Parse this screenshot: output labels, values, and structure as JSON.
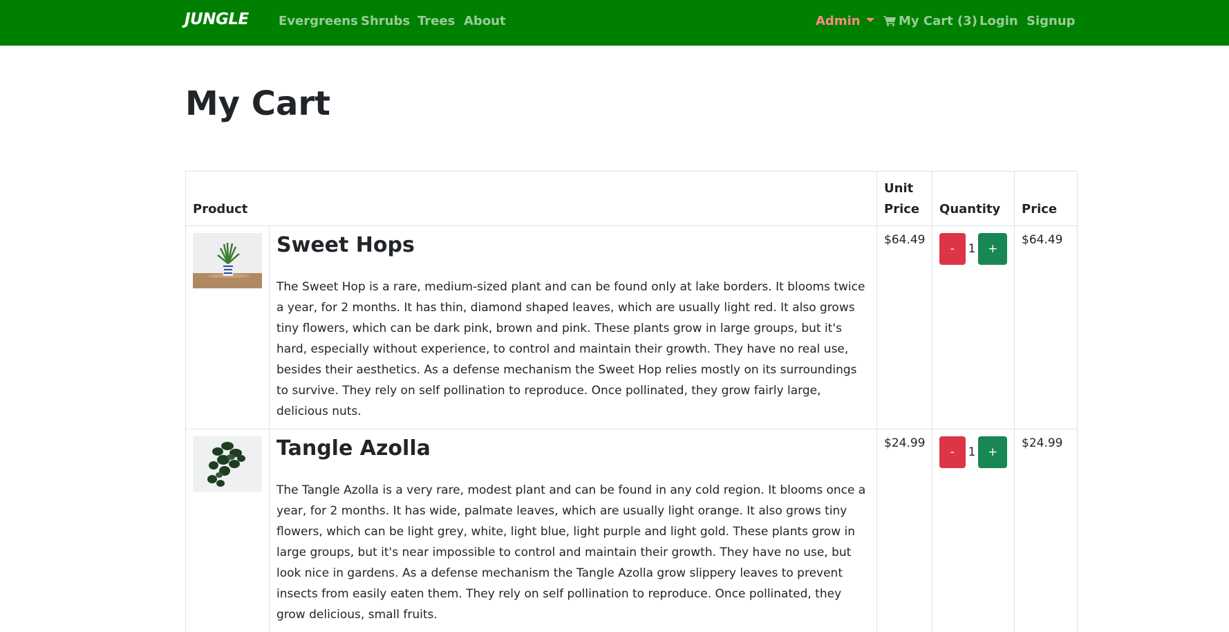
{
  "nav": {
    "brand": "JUNGLE",
    "links": [
      "Evergreens",
      "Shrubs",
      "Trees",
      "About"
    ],
    "admin": "Admin",
    "cart": "My Cart (3)",
    "login": "Login",
    "signup": "Signup",
    "colors": {
      "bg": "#008000",
      "admin": "#ff8a80"
    }
  },
  "page": {
    "title": "My Cart"
  },
  "table": {
    "headers": {
      "product": "Product",
      "unit_price": "Unit Price",
      "quantity": "Quantity",
      "price": "Price"
    },
    "rows": [
      {
        "image": "potted-palm-plant",
        "name": "Sweet Hops",
        "description": "The Sweet Hop is a rare, medium-sized plant and can be found only at lake borders. It blooms twice a year, for 2 months. It has thin, diamond shaped leaves, which are usually light red. It also grows tiny flowers, which can be dark pink, brown and pink. These plants grow in large groups, but it's hard, especially without experience, to control and maintain their growth. They have no real use, besides their aesthetics. As a defense mechanism the Sweet Hop relies mostly on its surroundings to survive. They rely on self pollination to reproduce. Once pollinated, they grow fairly large, delicious nuts.",
        "unit_price": "$64.49",
        "minus": "-",
        "qty": "1",
        "plus": "+",
        "price": "$64.49"
      },
      {
        "image": "hanging-vine-plant",
        "name": "Tangle Azolla",
        "description": "The Tangle Azolla is a very rare, modest plant and can be found in any cold region. It blooms once a year, for 2 months. It has wide, palmate leaves, which are usually light orange. It also grows tiny flowers, which can be light grey, white, light blue, light purple and light gold. These plants grow in large groups, but it's near impossible to control and maintain their growth. They have no use, but look nice in gardens. As a defense mechanism the Tangle Azolla grow slippery leaves to prevent insects from easily eaten them. They rely on self pollination to reproduce. Once pollinated, they grow delicious, small fruits.",
        "unit_price": "$24.99",
        "minus": "-",
        "qty": "1",
        "plus": "+",
        "price": "$24.99"
      }
    ]
  },
  "colors": {
    "minus_btn": "#dc3545",
    "plus_btn": "#198754"
  }
}
